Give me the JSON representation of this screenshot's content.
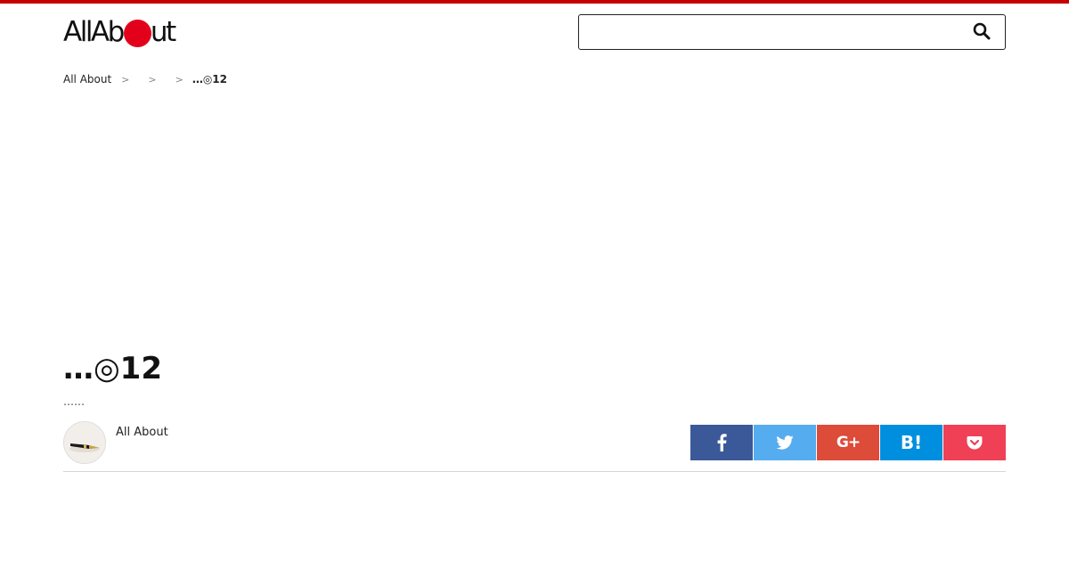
{
  "header": {
    "logo_left": "AllAb",
    "logo_right": "ut",
    "search": {
      "value": "",
      "placeholder": ""
    }
  },
  "breadcrumb": {
    "items": [
      "All About",
      "",
      ""
    ],
    "current": "…◎12"
  },
  "article": {
    "title": "…◎12",
    "subtitle": "……",
    "author": "All About"
  },
  "share": {
    "buttons": [
      {
        "name": "facebook",
        "label": "f",
        "color": "#3b5998",
        "icon": "facebook-icon"
      },
      {
        "name": "twitter",
        "label": "",
        "color": "#55acee",
        "icon": "twitter-icon"
      },
      {
        "name": "google-plus",
        "label": "G+",
        "color": "#dd4b39",
        "icon": "google-plus-icon"
      },
      {
        "name": "hatena",
        "label": "B!",
        "color": "#008fde",
        "icon": "hatena-bookmark-icon"
      },
      {
        "name": "pocket",
        "label": "",
        "color": "#ef4056",
        "icon": "pocket-icon"
      }
    ]
  },
  "colors": {
    "topbar": "#c40000",
    "logo_dot": "#e3001b",
    "divider": "#d6d6d6"
  }
}
